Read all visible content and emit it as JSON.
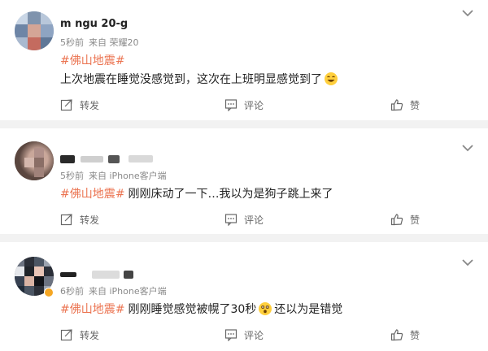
{
  "posts": [
    {
      "username": "m      ngu 20-g",
      "time": "5秒前",
      "source": "来自 荣耀20",
      "hashtag": "#佛山地震#",
      "text": "上次地震在睡觉没感觉到，这次在上班明显感觉到了",
      "emoji_icon": "laughing-emoji-icon",
      "repost_label": "转发",
      "comment_label": "评论",
      "like_label": "赞"
    },
    {
      "username": "",
      "time": "5秒前",
      "source": "来自 iPhone客户端",
      "hashtag": "#佛山地震#",
      "text": "刚刚床动了一下…我以为是狗子跳上来了",
      "repost_label": "转发",
      "comment_label": "评论",
      "like_label": "赞"
    },
    {
      "username": "",
      "time": "6秒前",
      "source": "来自 iPhone客户端",
      "hashtag": "#佛山地震#",
      "text_before": "刚刚睡觉感觉被幌了30秒",
      "emoji_icon": "surprised-emoji-icon",
      "text_after": "还以为是错觉",
      "repost_label": "转发",
      "comment_label": "评论",
      "like_label": "赞"
    }
  ],
  "colors": {
    "hashtag": "#eb7350",
    "meta": "#8a8a8a",
    "background": "#f2f2f2"
  }
}
